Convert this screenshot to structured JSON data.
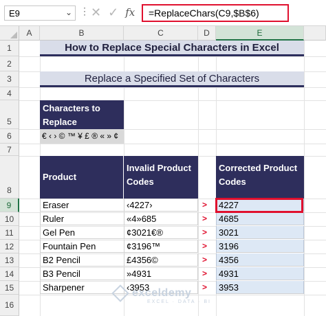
{
  "namebox": {
    "value": "E9"
  },
  "formula_bar": {
    "cancel_glyph": "✕",
    "enter_glyph": "✓",
    "fx_label": "fx",
    "formula": "=ReplaceChars(C9,$B$6)"
  },
  "columns": [
    "A",
    "B",
    "C",
    "D",
    "E"
  ],
  "rows": [
    "1",
    "2",
    "3",
    "4",
    "5",
    "6",
    "7",
    "8",
    "9",
    "10",
    "11",
    "12",
    "13",
    "14",
    "15",
    "16"
  ],
  "selected": {
    "column": "E",
    "row": "9"
  },
  "title": "How to Replace Special Characters in Excel",
  "subtitle": "Replace a Specified Set of Characters",
  "characters": {
    "header": "Characters to Replace",
    "value": "€ ‹ › © ™ ¥ £ ® « » ¢"
  },
  "table": {
    "headers": [
      "Product",
      "Invalid Product Codes",
      "Corrected Product Codes"
    ],
    "rows": [
      {
        "product": "Eraser",
        "invalid": "‹4227›",
        "corrected": "4227"
      },
      {
        "product": "Ruler",
        "invalid": "«4»685",
        "corrected": "4685"
      },
      {
        "product": "Gel Pen",
        "invalid": "¢3021€®",
        "corrected": "3021"
      },
      {
        "product": "Fountain Pen",
        "invalid": "¢3196™",
        "corrected": "3196"
      },
      {
        "product": "B2 Pencil",
        "invalid": "£4356©",
        "corrected": "4356"
      },
      {
        "product": "B3 Pencil",
        "invalid": "»4931",
        "corrected": "4931"
      },
      {
        "product": "Sharpener",
        "invalid": "‹3953",
        "corrected": "3953"
      }
    ],
    "arrow": ">"
  },
  "watermark": {
    "name": "exceldemy",
    "tagline": "EXCEL · DATA · BI"
  },
  "colors": {
    "header_fill": "#2e2e5c",
    "title_fill": "#d9dde9",
    "result_fill": "#dde8f5",
    "highlight": "#e0102e"
  }
}
